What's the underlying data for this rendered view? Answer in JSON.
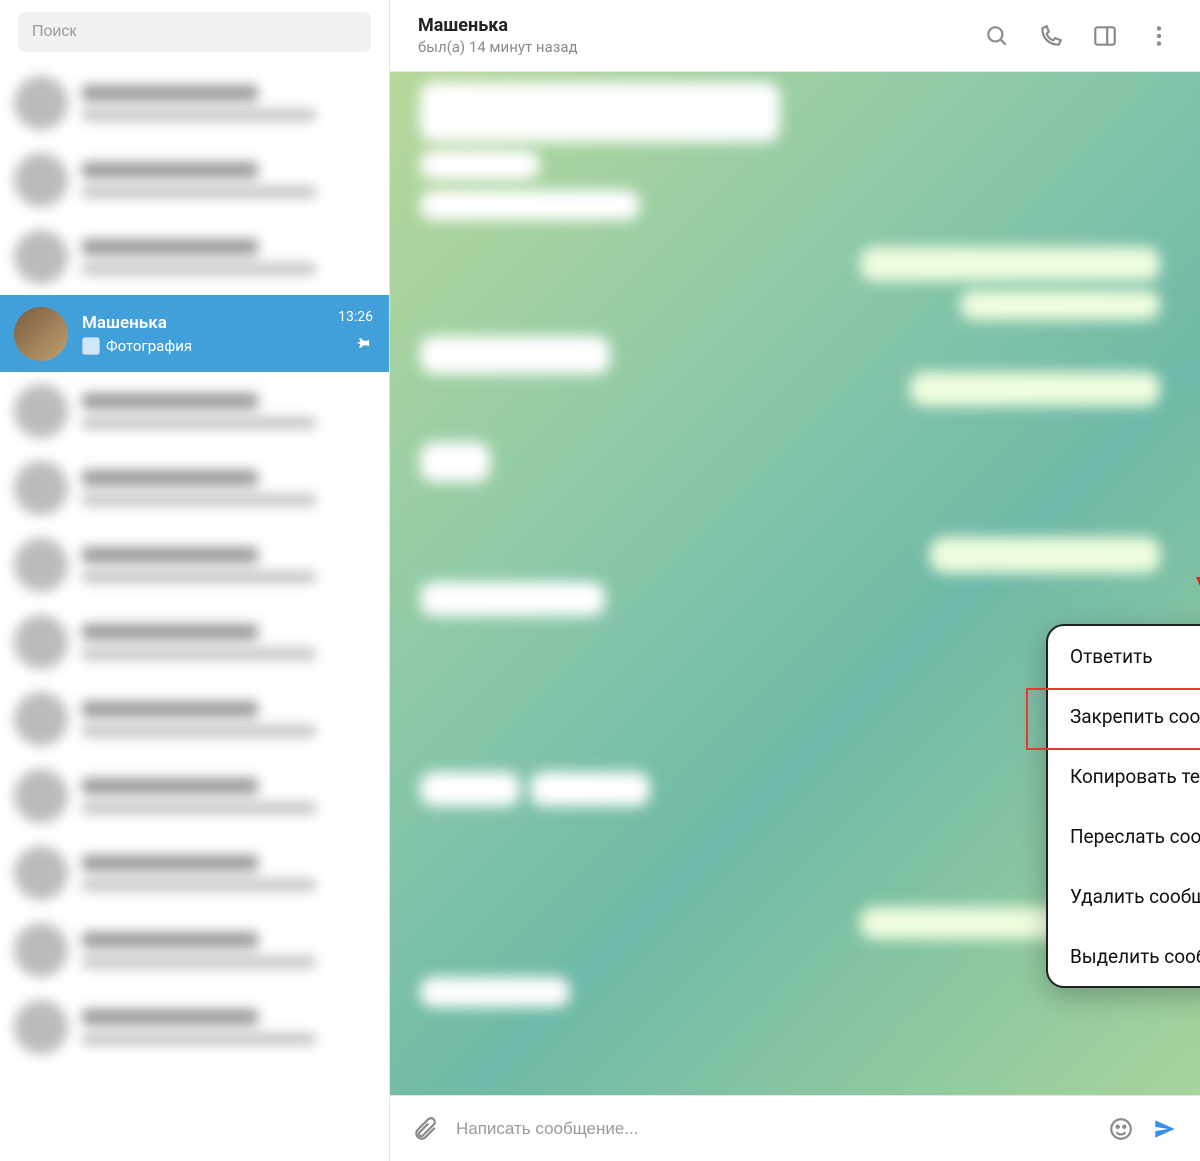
{
  "sidebar": {
    "search_placeholder": "Поиск",
    "selected_chat": {
      "name": "Машенька",
      "subtitle": "Фотография",
      "time": "13:26"
    }
  },
  "header": {
    "title": "Машенька",
    "status": "был(а) 14 минут назад"
  },
  "context_menu": {
    "items": [
      {
        "label": "Ответить"
      },
      {
        "label": "Закрепить сообщение",
        "highlighted": true
      },
      {
        "label": "Копировать текст"
      },
      {
        "label": "Переслать сообщение"
      },
      {
        "label": "Удалить сообщение"
      },
      {
        "label": "Выделить сообщение"
      }
    ]
  },
  "composer": {
    "placeholder": "Написать сообщение..."
  },
  "colors": {
    "selection": "#419fd9",
    "send": "#3390ec",
    "highlight": "#e53a2f"
  }
}
